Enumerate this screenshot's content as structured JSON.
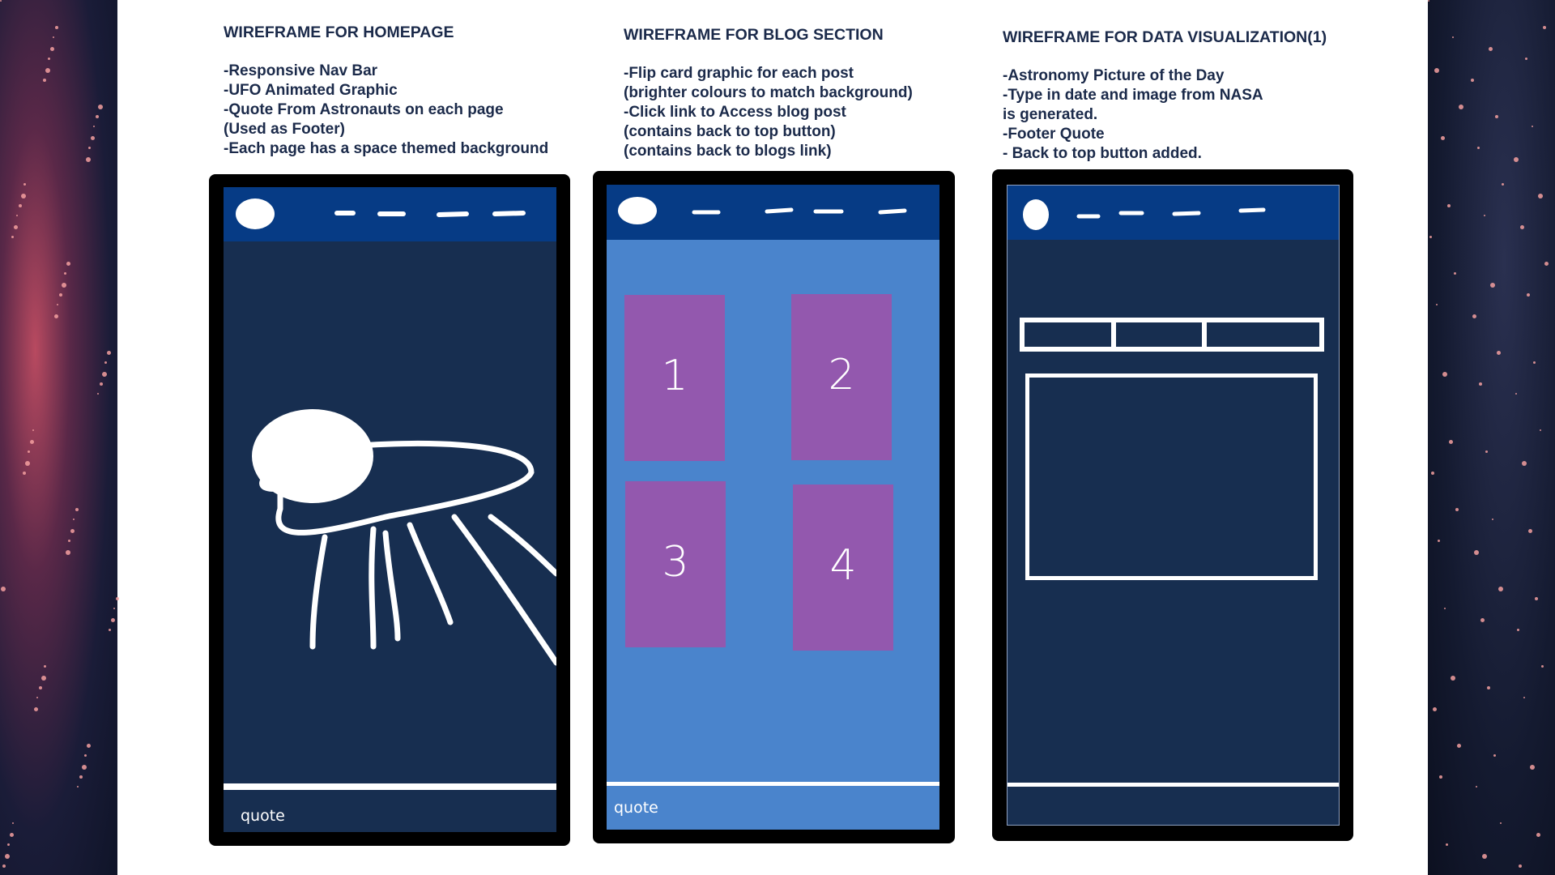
{
  "columns": [
    {
      "title": "WIREFRAME FOR HOMEPAGE",
      "lines": [
        "-Responsive Nav Bar",
        "-UFO Animated Graphic",
        "-Quote From Astronauts on each page",
        "(Used as Footer)",
        "-Each page has a space themed background"
      ]
    },
    {
      "title": "WIREFRAME FOR BLOG SECTION",
      "lines": [
        "-Flip card graphic for each post",
        "(brighter colours to match background)",
        "-Click link to Access blog post",
        "(contains back to top button)",
        "(contains back to blogs link)"
      ]
    },
    {
      "title": "WIREFRAME FOR DATA VISUALIZATION(1)",
      "lines": [
        "-Astronomy Picture of the Day",
        "-Type in date and image from NASA",
        "is generated.",
        "-Footer Quote",
        "- Back to top button added."
      ]
    }
  ],
  "home": {
    "footer": "quote"
  },
  "blog": {
    "footer": "quote",
    "cards": [
      "1",
      "2",
      "3",
      "4"
    ]
  },
  "colors": {
    "nav": "#063b85",
    "dark": "#172e50",
    "blog_bg": "#4a84cc",
    "card": "#9358ae"
  }
}
